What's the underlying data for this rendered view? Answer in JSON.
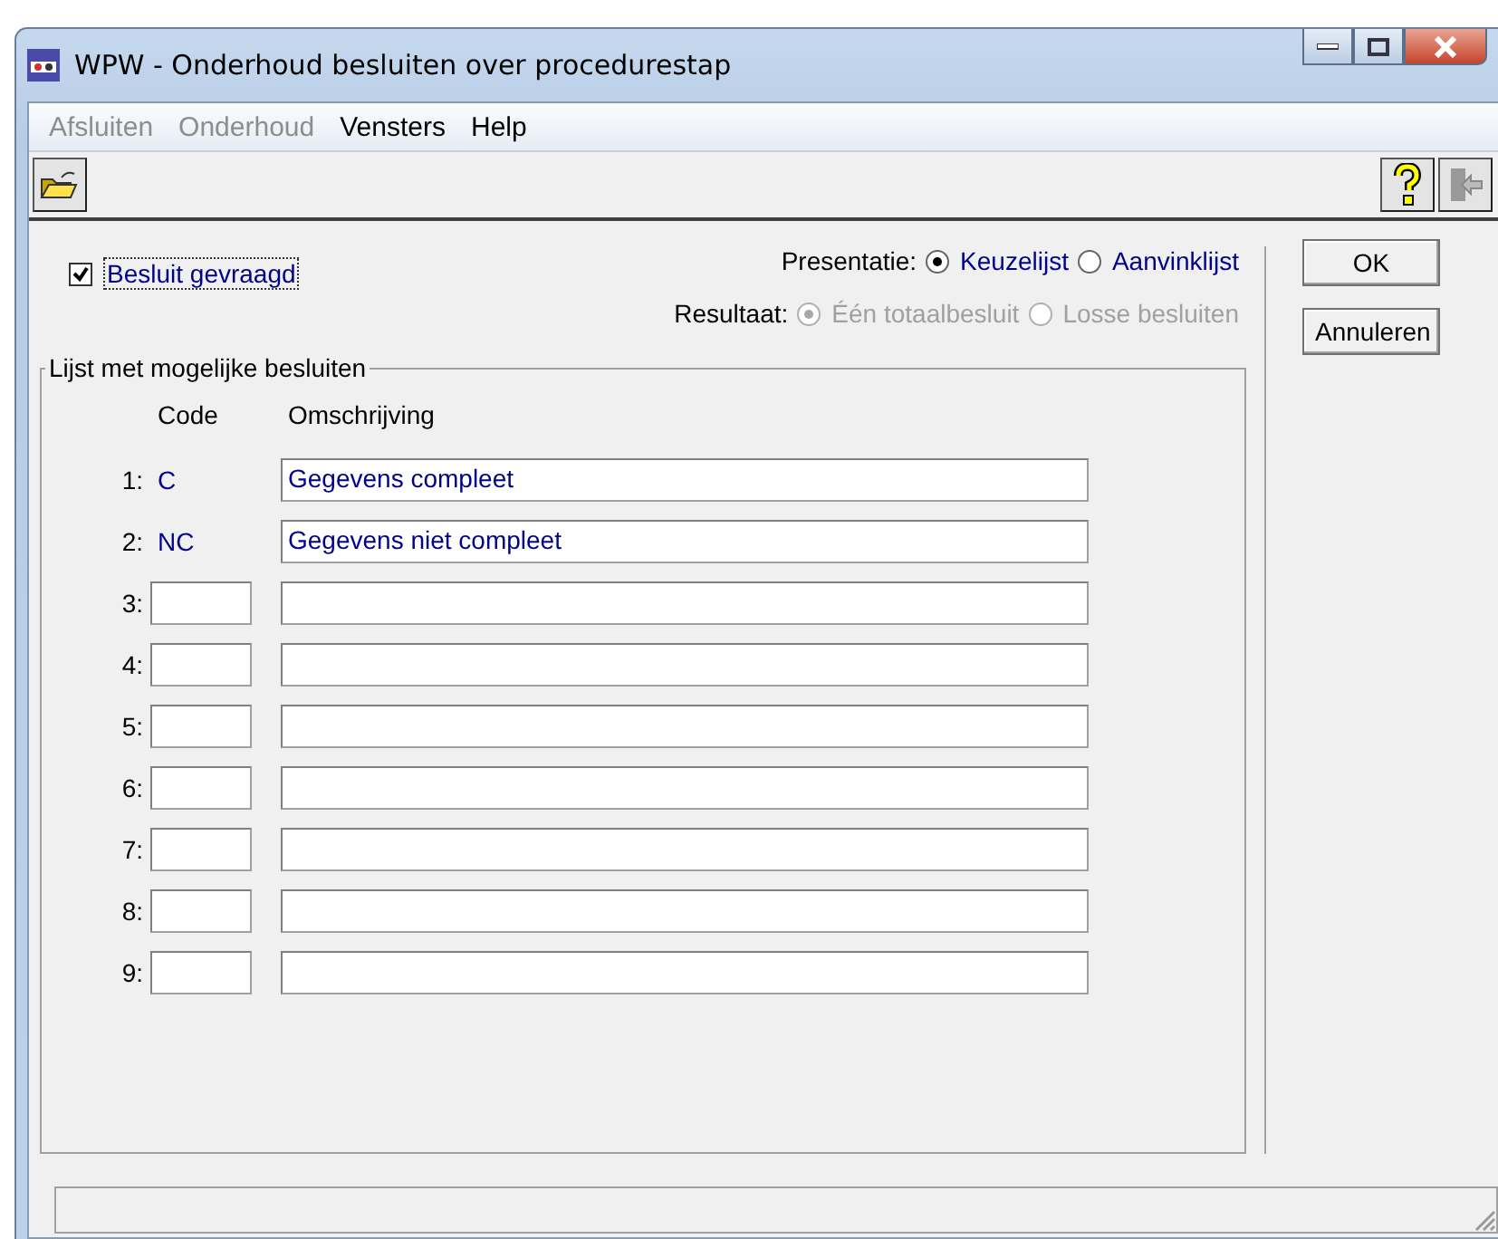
{
  "window": {
    "title": "WPW - Onderhoud besluiten over procedurestap"
  },
  "menu": [
    {
      "label": "Afsluiten",
      "disabled": true
    },
    {
      "label": "Onderhoud",
      "disabled": true
    },
    {
      "label": "Vensters",
      "disabled": false
    },
    {
      "label": "Help",
      "disabled": false
    }
  ],
  "checkbox": {
    "label": "Besluit gevraagd",
    "checked": true
  },
  "presentatie": {
    "label": "Presentatie:",
    "disabled": false,
    "options": [
      {
        "label": "Keuzelijst",
        "selected": true
      },
      {
        "label": "Aanvinklijst",
        "selected": false
      }
    ]
  },
  "resultaat": {
    "label": "Resultaat:",
    "disabled": true,
    "options": [
      {
        "label": "Één totaalbesluit",
        "selected": true
      },
      {
        "label": "Losse besluiten",
        "selected": false
      }
    ]
  },
  "buttons": [
    "OK",
    "Annuleren"
  ],
  "group": {
    "title": "Lijst met mogelijke besluiten",
    "columns": [
      "Code",
      "Omschrijving"
    ],
    "rows": [
      {
        "number": "1:",
        "kind": "text",
        "code": "C",
        "description": "Gegevens compleet"
      },
      {
        "number": "2:",
        "kind": "text",
        "code": "NC",
        "description": "Gegevens niet compleet"
      },
      {
        "number": "3:",
        "kind": "field"
      },
      {
        "number": "4:",
        "kind": "field"
      },
      {
        "number": "5:",
        "kind": "field"
      },
      {
        "number": "6:",
        "kind": "field"
      },
      {
        "number": "7:",
        "kind": "field"
      },
      {
        "number": "8:",
        "kind": "field"
      },
      {
        "number": "9:",
        "kind": "field"
      }
    ]
  }
}
